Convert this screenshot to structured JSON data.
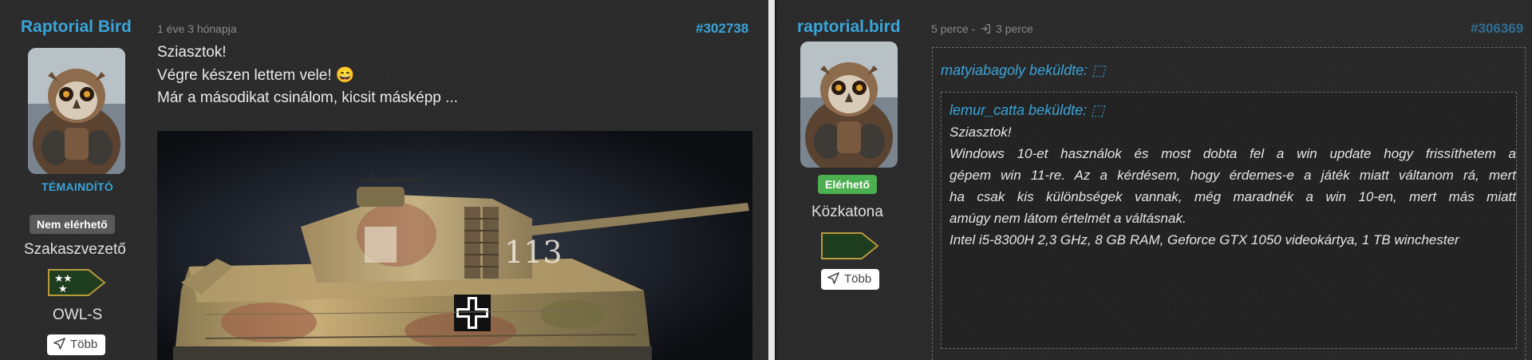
{
  "left_post": {
    "username": "Raptorial Bird",
    "role_tag": "TÉMAINDÍTÓ",
    "status": "Nem elérhető",
    "rank": "Szakaszvezető",
    "title": "OWL-S",
    "more_label": "Több",
    "meta": "1 éve 3 hónapja",
    "post_number": "#302738",
    "message_lines": [
      "Sziasztok!",
      "Végre készen lettem vele! 😄",
      "Már a másodikat csinálom, kicsit másképp ..."
    ],
    "image_alt": "Tiger tank model",
    "turret_number": "113"
  },
  "right_post": {
    "username": "raptorial.bird",
    "status": "Elérhető",
    "rank": "Közkatona",
    "more_label": "Több",
    "meta_time": "5 perce -",
    "meta_edit": "3 perce",
    "post_number": "#306369",
    "outer_quote_author": "matyiabagoly beküldte: ",
    "inner_quote_author": "lemur_catta beküldte: ",
    "quote_lines": [
      "Sziasztok!",
      "Windows 10-et használok és most dobta fel a win update hogy frissíthetem a",
      "gépem win 11-re. Az a kérdésem, hogy érdemes-e a játék miatt váltanom rá, mert",
      "ha csak kis különbségek vannak, még maradnék a win 10-en, mert más miatt",
      "amúgy nem látom értelmét a váltásnak.",
      "Intel i5-8300H 2,3 GHz, 8 GB RAM, Geforce GTX 1050 videokártya, 1 TB winchester"
    ]
  },
  "colors": {
    "accent": "#3aa4d8",
    "online": "#4caf50",
    "offline": "#5a5a5a",
    "rank_badge": "#1f3d1f"
  }
}
